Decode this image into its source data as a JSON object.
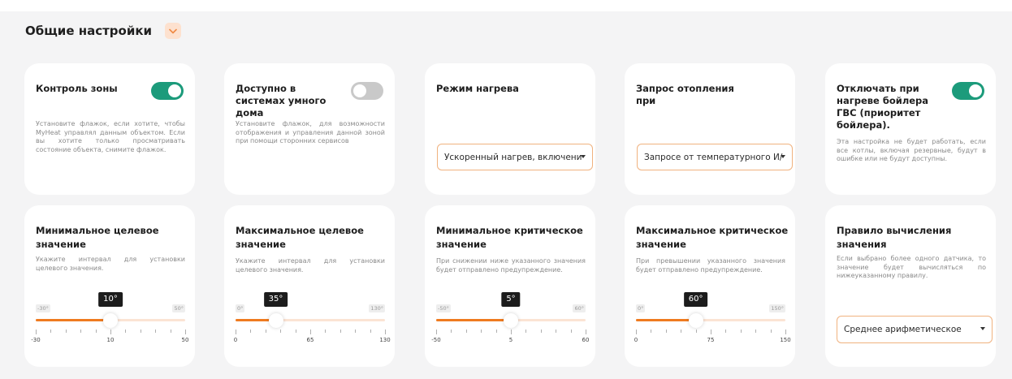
{
  "section": {
    "title": "Общие настройки"
  },
  "cards": {
    "zone_control": {
      "title": "Контроль зоны",
      "description": "Установите флажок, если хотите, чтобы MyHeat управлял данным объектом. Если вы хотите только просматривать состояние объекта, снимите флажок.",
      "toggle_on": true
    },
    "smart_home": {
      "title": "Доступно в системах умного дома",
      "description": "Установите флажок, для возможности отображения и управления данной зоной при помощи сторонних сервисов",
      "toggle_on": false
    },
    "heating_mode": {
      "title": "Режим нагрева",
      "selected": "Ускоренный нагрев, включени"
    },
    "heating_request": {
      "title": "Запрос отопления при",
      "selected": "Запросе от температурного И/"
    },
    "dhw_priority": {
      "title": "Отключать при нагреве бойлера ГВС (приоритет бойлера).",
      "description": "Эта настройка не будет работать, если все котлы, включая резервные, будут в ошибке или не будут доступны.",
      "toggle_on": true
    },
    "min_target": {
      "title": "Минимальное целевое значение",
      "description": "Укажите интервал для установки целевого значения.",
      "value": 10,
      "value_label": "10°",
      "min": -30,
      "max": 50,
      "min_label": "-30°",
      "max_label": "50°",
      "tick_labels": [
        "-30",
        "10",
        "50"
      ]
    },
    "max_target": {
      "title": "Максимальное целевое значение",
      "description": "Укажите интервал для установки целевого значения.",
      "value": 35,
      "value_label": "35°",
      "min": 0,
      "max": 130,
      "min_label": "0°",
      "max_label": "130°",
      "tick_labels": [
        "0",
        "65",
        "130"
      ]
    },
    "min_critical": {
      "title": "Минимальное критическое значение",
      "description": "При снижении ниже указанного значения будет отправлено предупреждение.",
      "value": 5,
      "value_label": "5°",
      "min": -50,
      "max": 60,
      "min_label": "-50°",
      "max_label": "60°",
      "tick_labels": [
        "-50",
        "5",
        "60"
      ]
    },
    "max_critical": {
      "title": "Максимальное критическое значение",
      "description": "При превышении указанного значения будет отправлено предупреждение.",
      "value": 60,
      "value_label": "60°",
      "min": 0,
      "max": 150,
      "min_label": "0°",
      "max_label": "150°",
      "tick_labels": [
        "0",
        "75",
        "150"
      ]
    },
    "calc_rule": {
      "title": "Правило вычисления значения",
      "description": "Если выбрано более одного датчика, то значение будет вычисляться по нижеуказанному правилу.",
      "selected": "Среднее арифметическое"
    }
  },
  "colors": {
    "accent_orange": "#ef7b20",
    "toggle_on": "#1c9b7b",
    "toggle_off": "#c9c9c9",
    "select_border": "#f0b27f"
  },
  "icons": {
    "collapse": "chevron-down-icon"
  }
}
